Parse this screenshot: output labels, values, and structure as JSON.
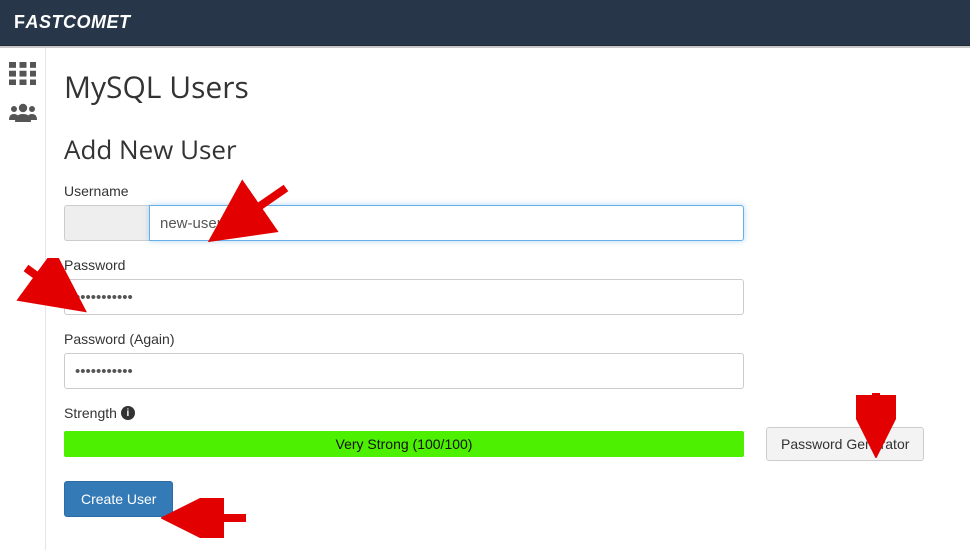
{
  "brand": "FASTCOMET",
  "page_title": "MySQL Users",
  "section_title": "Add New User",
  "form": {
    "username_label": "Username",
    "username_value": "new-user",
    "password_label": "Password",
    "password_value": "•••••••••••",
    "password_again_label": "Password (Again)",
    "password_again_value": "•••••••••••",
    "strength_label": "Strength",
    "strength_text": "Very Strong (100/100)",
    "password_generator_label": "Password Generator",
    "submit_label": "Create User"
  }
}
